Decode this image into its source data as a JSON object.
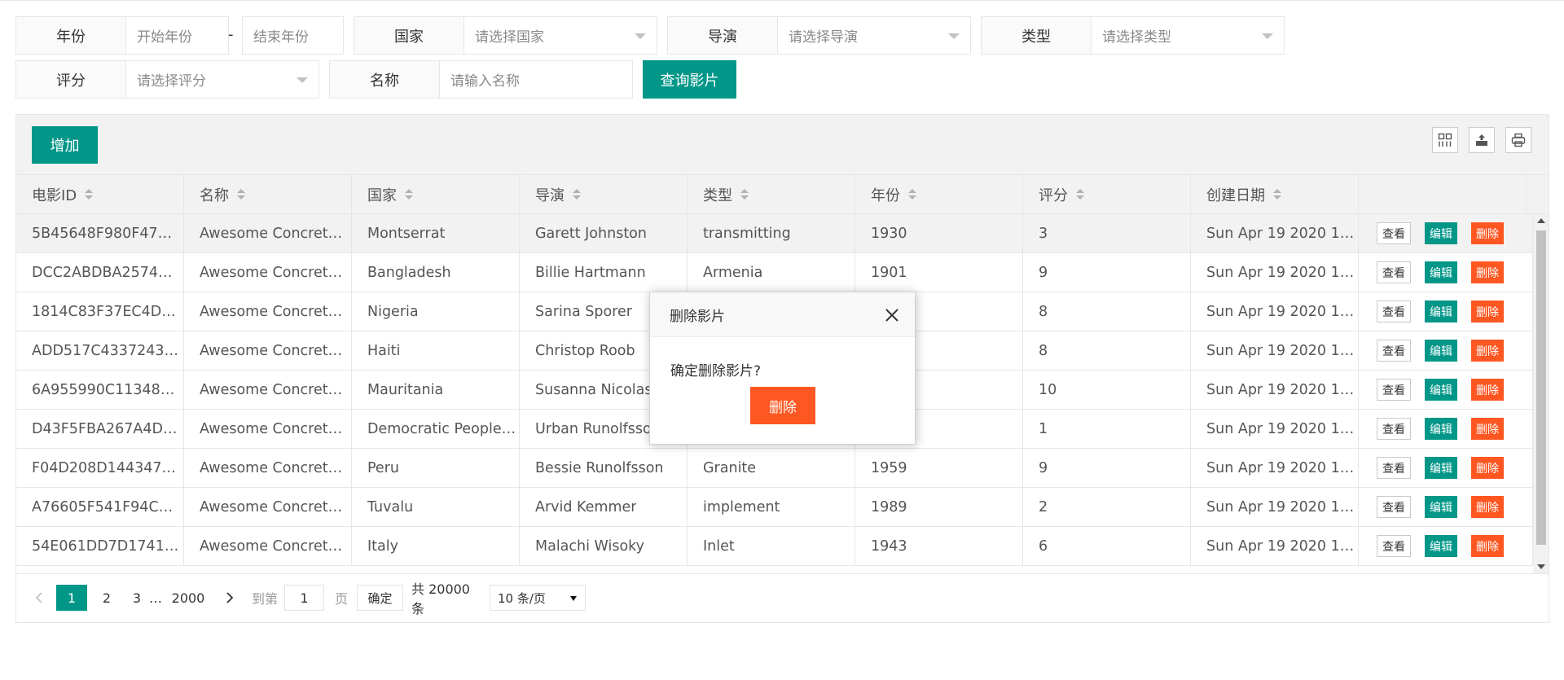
{
  "filters": {
    "year": {
      "label": "年份",
      "start_placeholder": "开始年份",
      "separator": "-",
      "end_placeholder": "结束年份"
    },
    "country": {
      "label": "国家",
      "placeholder": "请选择国家"
    },
    "director": {
      "label": "导演",
      "placeholder": "请选择导演"
    },
    "genre": {
      "label": "类型",
      "placeholder": "请选择类型"
    },
    "rating": {
      "label": "评分",
      "placeholder": "请选择评分"
    },
    "name": {
      "label": "名称",
      "placeholder": "请输入名称"
    },
    "query_button": "查询影片"
  },
  "toolbar": {
    "add_button": "增加",
    "icons": [
      "columns-filter-icon",
      "export-icon",
      "print-icon"
    ]
  },
  "table": {
    "columns": [
      "电影ID",
      "名称",
      "国家",
      "导演",
      "类型",
      "年份",
      "评分",
      "创建日期"
    ],
    "row_actions": {
      "view": "查看",
      "edit": "编辑",
      "delete": "删除"
    },
    "rows": [
      [
        "5B45648F980F47…",
        "Awesome Concret…",
        "Montserrat",
        "Garett Johnston",
        "transmitting",
        "1930",
        "3",
        "Sun Apr 19 2020 1…"
      ],
      [
        "DCC2ABDBA2574…",
        "Awesome Concret…",
        "Bangladesh",
        "Billie Hartmann",
        "Armenia",
        "1901",
        "9",
        "Sun Apr 19 2020 1…"
      ],
      [
        "1814C83F37EC4D…",
        "Awesome Concret…",
        "Nigeria",
        "Sarina Sporer",
        "",
        "",
        "8",
        "Sun Apr 19 2020 1…"
      ],
      [
        "ADD517C4337243…",
        "Awesome Concret…",
        "Haiti",
        "Christop Roob",
        "",
        "",
        "8",
        "Sun Apr 19 2020 1…"
      ],
      [
        "6A955990C113488…",
        "Awesome Concret…",
        "Mauritania",
        "Susanna Nicolas",
        "",
        "",
        "10",
        "Sun Apr 19 2020 1…"
      ],
      [
        "D43F5FBA267A4D…",
        "Awesome Concret…",
        "Democratic People…",
        "Urban Runolfsson",
        "",
        "",
        "1",
        "Sun Apr 19 2020 1…"
      ],
      [
        "F04D208D144347…",
        "Awesome Concret…",
        "Peru",
        "Bessie Runolfsson",
        "Granite",
        "1959",
        "9",
        "Sun Apr 19 2020 1…"
      ],
      [
        "A76605F541F94C…",
        "Awesome Concret…",
        "Tuvalu",
        "Arvid Kemmer",
        "implement",
        "1989",
        "2",
        "Sun Apr 19 2020 1…"
      ],
      [
        "54E061DD7D1741…",
        "Awesome Concret…",
        "Italy",
        "Malachi Wisoky",
        "Inlet",
        "1943",
        "6",
        "Sun Apr 19 2020 1…"
      ]
    ]
  },
  "pagination": {
    "pages": [
      "1",
      "2",
      "3"
    ],
    "ellipsis": "…",
    "last_page": "2000",
    "goto_label": "到第",
    "goto_value": "1",
    "page_unit": "页",
    "confirm": "确定",
    "total": "共 20000 条",
    "page_size": "10 条/页"
  },
  "dialog": {
    "title": "删除影片",
    "message": "确定删除影片?",
    "confirm_button": "删除"
  },
  "colors": {
    "primary": "#009688",
    "danger": "#ff5722"
  }
}
